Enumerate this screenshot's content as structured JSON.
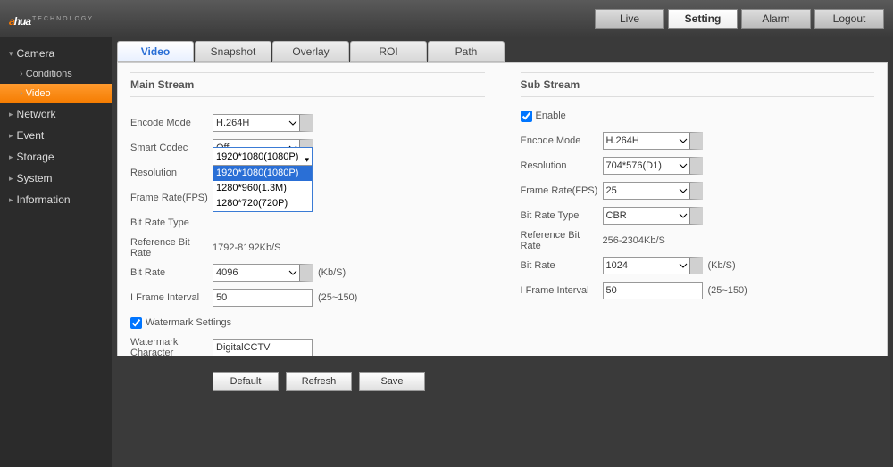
{
  "brand": {
    "prefix": "a",
    "suffix": "hua",
    "sub": "TECHNOLOGY"
  },
  "nav": {
    "live": "Live",
    "setting": "Setting",
    "alarm": "Alarm",
    "logout": "Logout"
  },
  "sidebar": {
    "camera": "Camera",
    "conditions": "Conditions",
    "video": "Video",
    "network": "Network",
    "event": "Event",
    "storage": "Storage",
    "system": "System",
    "information": "Information"
  },
  "tabs": {
    "video": "Video",
    "snapshot": "Snapshot",
    "overlay": "Overlay",
    "roi": "ROI",
    "path": "Path"
  },
  "main_stream": {
    "title": "Main Stream",
    "encode_mode_lbl": "Encode Mode",
    "encode_mode": "H.264H",
    "smart_codec_lbl": "Smart Codec",
    "smart_codec": "Off",
    "resolution_lbl": "Resolution",
    "resolution": "1920*1080(1080P)",
    "resolution_options": [
      "1920*1080(1080P)",
      "1280*960(1.3M)",
      "1280*720(720P)"
    ],
    "fps_lbl": "Frame Rate(FPS)",
    "brtype_lbl": "Bit Rate Type",
    "refbr_lbl": "Reference Bit Rate",
    "refbr": "1792-8192Kb/S",
    "bitrate_lbl": "Bit Rate",
    "bitrate": "4096",
    "bitrate_suffix": "(Kb/S)",
    "iframe_lbl": "I Frame Interval",
    "iframe": "50",
    "iframe_suffix": "(25~150)",
    "watermark_lbl": "Watermark Settings",
    "wmchar_lbl": "Watermark Character",
    "wmchar": "DigitalCCTV"
  },
  "sub_stream": {
    "title": "Sub Stream",
    "enable_lbl": "Enable",
    "encode_mode_lbl": "Encode Mode",
    "encode_mode": "H.264H",
    "resolution_lbl": "Resolution",
    "resolution": "704*576(D1)",
    "fps_lbl": "Frame Rate(FPS)",
    "fps": "25",
    "brtype_lbl": "Bit Rate Type",
    "brtype": "CBR",
    "refbr_lbl": "Reference Bit Rate",
    "refbr": "256-2304Kb/S",
    "bitrate_lbl": "Bit Rate",
    "bitrate": "1024",
    "bitrate_suffix": "(Kb/S)",
    "iframe_lbl": "I Frame Interval",
    "iframe": "50",
    "iframe_suffix": "(25~150)"
  },
  "actions": {
    "default": "Default",
    "refresh": "Refresh",
    "save": "Save"
  }
}
